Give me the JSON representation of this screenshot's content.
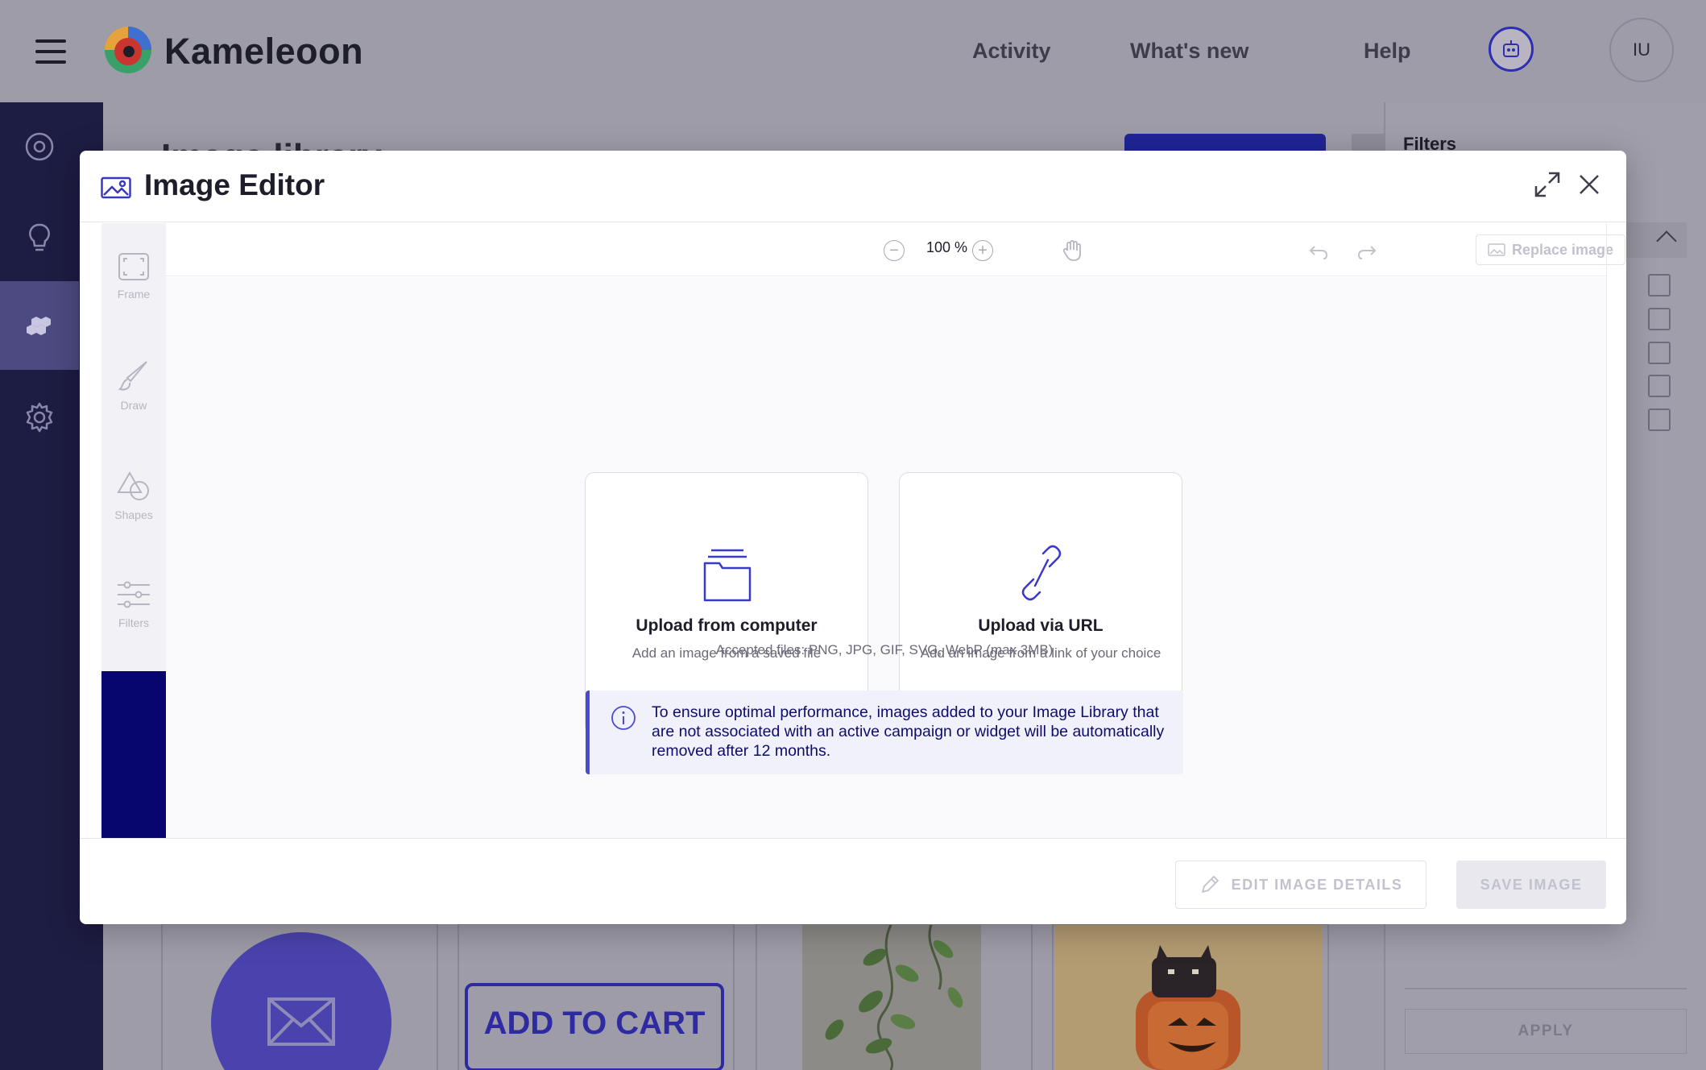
{
  "app": {
    "brand": "Kameleoon",
    "nav": {
      "activity": "Activity",
      "whats_new": "What's new",
      "help": "Help"
    },
    "user_initials": "IU"
  },
  "background": {
    "page_title": "Image library",
    "filters_title": "Filters",
    "apply_label": "APPLY",
    "add_to_cart_text": "ADD TO CART"
  },
  "modal": {
    "title": "Image Editor",
    "tools": [
      {
        "label": "Frame",
        "icon": "frame-icon"
      },
      {
        "label": "Draw",
        "icon": "brush-icon"
      },
      {
        "label": "Shapes",
        "icon": "shapes-icon"
      },
      {
        "label": "Filters",
        "icon": "sliders-icon"
      }
    ],
    "toolbar": {
      "zoom": "100 %",
      "minus": "−",
      "plus": "+",
      "replace_label": "Replace image"
    },
    "upload_computer": {
      "title": "Upload from computer",
      "subtitle": "Add an image from a saved file",
      "icon": "folder-icon"
    },
    "upload_url": {
      "title": "Upload via URL",
      "subtitle": "Add an image from a link of your choice",
      "icon": "link-icon"
    },
    "accepted_files": "Accepted files: PNG, JPG, GIF, SVG, WebP (max 3MB)",
    "notice": "To ensure optimal performance, images added to your Image Library that are not associated with an active campaign or widget will be automatically removed after 12 months.",
    "footer": {
      "edit_details": "EDIT IMAGE DETAILS",
      "save": "SAVE IMAGE"
    }
  },
  "colors": {
    "accent": "#4a4ad0",
    "nav_dark": "#1d1c42",
    "tools_accent": "#06066e"
  }
}
